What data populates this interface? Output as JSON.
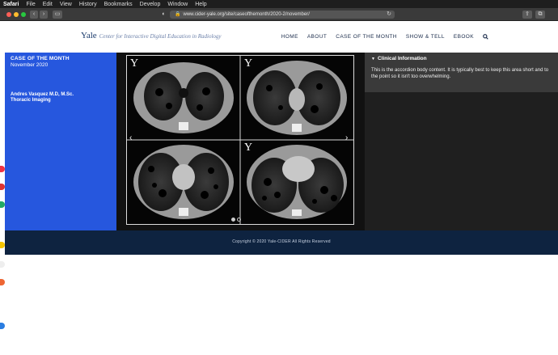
{
  "menubar": {
    "app": "Safari",
    "items": [
      "File",
      "Edit",
      "View",
      "History",
      "Bookmarks",
      "Develop",
      "Window",
      "Help"
    ]
  },
  "browser": {
    "url": "www.cider-yale.org/site/caseofthemonth/2020-2/november/",
    "icons": [
      "back-icon",
      "forward-icon",
      "sidebar-icon",
      "shield-icon",
      "lock-icon",
      "reload-icon",
      "share-icon",
      "tabs-icon"
    ]
  },
  "site": {
    "logo": "Yale",
    "logo_subtitle": "Center for Interactive Digital Education in Radiology",
    "nav": [
      "HOME",
      "ABOUT",
      "CASE OF THE MONTH",
      "SHOW & TELL",
      "EBOOK"
    ],
    "nav_search_icon": "search-icon"
  },
  "case": {
    "title": "CASE OF THE MONTH",
    "date": "November 2020",
    "author": "Andres Vasquez M.D, M.Sc.",
    "department": "Thoracic Imaging"
  },
  "viewer": {
    "watermark": "Y",
    "slide_count": 2,
    "active_slide": 1
  },
  "accordion": {
    "title": "Clinical Information",
    "body": "This is the accordion body content. It is typically best to keep this area short and to the point so it isn't too overwhelming."
  },
  "footer": {
    "copyright": "Copyright © 2020 Yale-CIDER All Rights Reserved"
  },
  "colors": {
    "panel_blue": "#2657de",
    "footer_navy": "#0e2340",
    "dark_panel": "#1f1f1f"
  }
}
